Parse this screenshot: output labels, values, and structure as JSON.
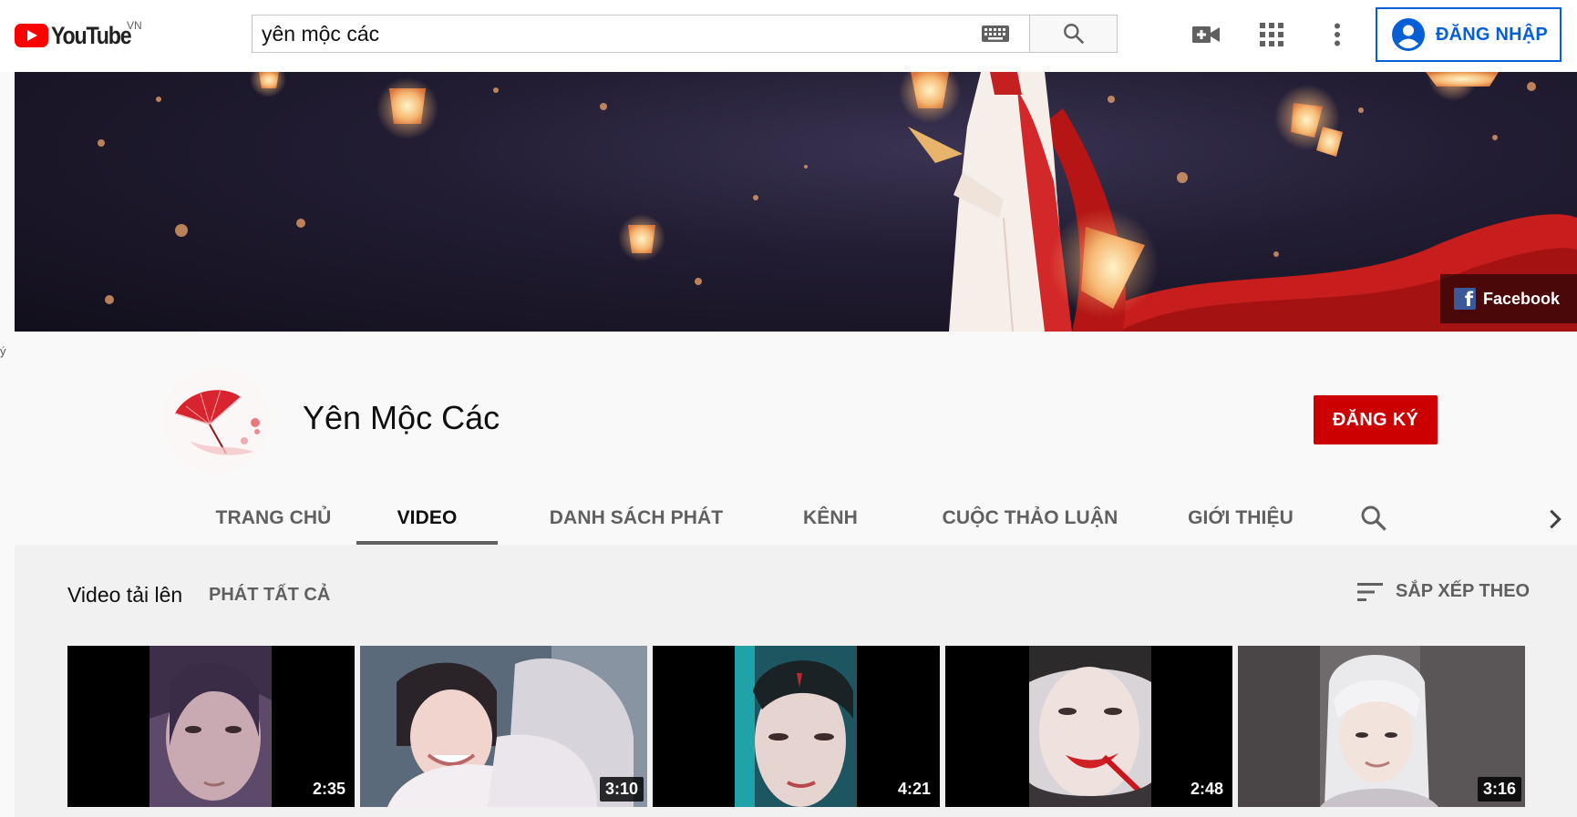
{
  "masthead": {
    "logo_text": "YouTube",
    "country_code": "VN",
    "search_value": "yên mộc các",
    "signin_label": "ĐĂNG NHẬP"
  },
  "banner": {
    "link_label": "Facebook"
  },
  "edge_char": "ý",
  "channel": {
    "name": "Yên Mộc Các",
    "subscribe_label": "ĐĂNG KÝ",
    "tabs": [
      {
        "label": "TRANG CHỦ",
        "active": false
      },
      {
        "label": "VIDEO",
        "active": true
      },
      {
        "label": "DANH SÁCH PHÁT",
        "active": false
      },
      {
        "label": "KÊNH",
        "active": false
      },
      {
        "label": "CUỘC THẢO LUẬN",
        "active": false
      },
      {
        "label": "GIỚI THIỆU",
        "active": false
      }
    ]
  },
  "uploads": {
    "title": "Video tải lên",
    "play_all_label": "PHÁT TẤT CẢ",
    "sort_label": "SẮP XẾP THEO",
    "videos": [
      {
        "duration": "2:35"
      },
      {
        "duration": "3:10"
      },
      {
        "duration": "4:21"
      },
      {
        "duration": "2:48"
      },
      {
        "duration": "3:16"
      }
    ]
  },
  "icons": {
    "search": "search-icon",
    "keyboard": "keyboard-icon",
    "create_video": "video-camera-icon",
    "apps": "apps-grid-icon",
    "settings": "more-vertical-icon",
    "account": "account-circle-icon",
    "sort": "sort-icon",
    "next_tabs": "chevron-right-icon"
  },
  "colors": {
    "brand_red": "#ff0000",
    "subscribe_red": "#cc0000",
    "link_blue": "#065fd4",
    "facebook_blue": "#3b5998"
  }
}
